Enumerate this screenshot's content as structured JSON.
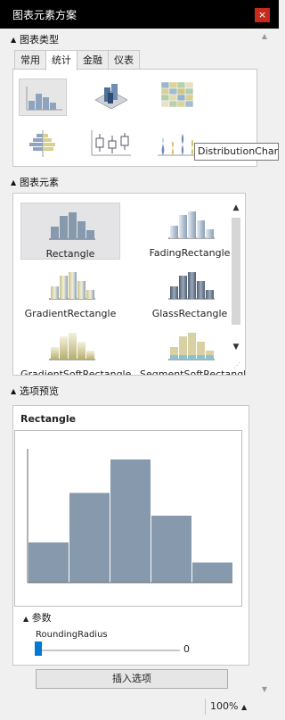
{
  "window": {
    "title": "图表元素方案",
    "close_glyph": "×"
  },
  "sections": {
    "chart_type": "图表类型",
    "chart_elements": "图表元素",
    "option_preview": "选项预览",
    "parameters": "参数"
  },
  "tabs": [
    {
      "label": "常用",
      "active": false
    },
    {
      "label": "统计",
      "active": true
    },
    {
      "label": "金融",
      "active": false
    },
    {
      "label": "仪表",
      "active": false
    }
  ],
  "chart_types": [
    {
      "icon": "histogram-chart-icon",
      "selected": true
    },
    {
      "icon": "3d-bar-chart-icon",
      "selected": false
    },
    {
      "icon": "heatmap-chart-icon",
      "selected": false
    },
    {
      "icon": "population-pyramid-icon",
      "selected": false
    },
    {
      "icon": "boxplot-chart-icon",
      "selected": false
    },
    {
      "icon": "distribution-chart-icon",
      "selected": false
    }
  ],
  "tooltip": "DistributionChart",
  "elements": [
    {
      "label": "Rectangle",
      "selected": true
    },
    {
      "label": "FadingRectangle",
      "selected": false
    },
    {
      "label": "GradientRectangle",
      "selected": false
    },
    {
      "label": "GlassRectangle",
      "selected": false
    },
    {
      "label": "GradientSoftRectangle",
      "selected": false
    },
    {
      "label": "SegmentSoftRectangle",
      "selected": false
    }
  ],
  "preview": {
    "title": "Rectangle",
    "chart_data": {
      "type": "bar",
      "values": [
        30,
        67,
        92,
        50,
        15
      ],
      "ylim": [
        0,
        100
      ],
      "grid": false,
      "bar_color": "#8699ad"
    }
  },
  "parameter": {
    "name": "RoundingRadius",
    "value": "0"
  },
  "insert_button": "插入选项",
  "statusbar": {
    "zoom": "100%"
  },
  "colors": {
    "accent": "#0078d4",
    "close": "#c42b1c",
    "bar": "#8699ad"
  }
}
